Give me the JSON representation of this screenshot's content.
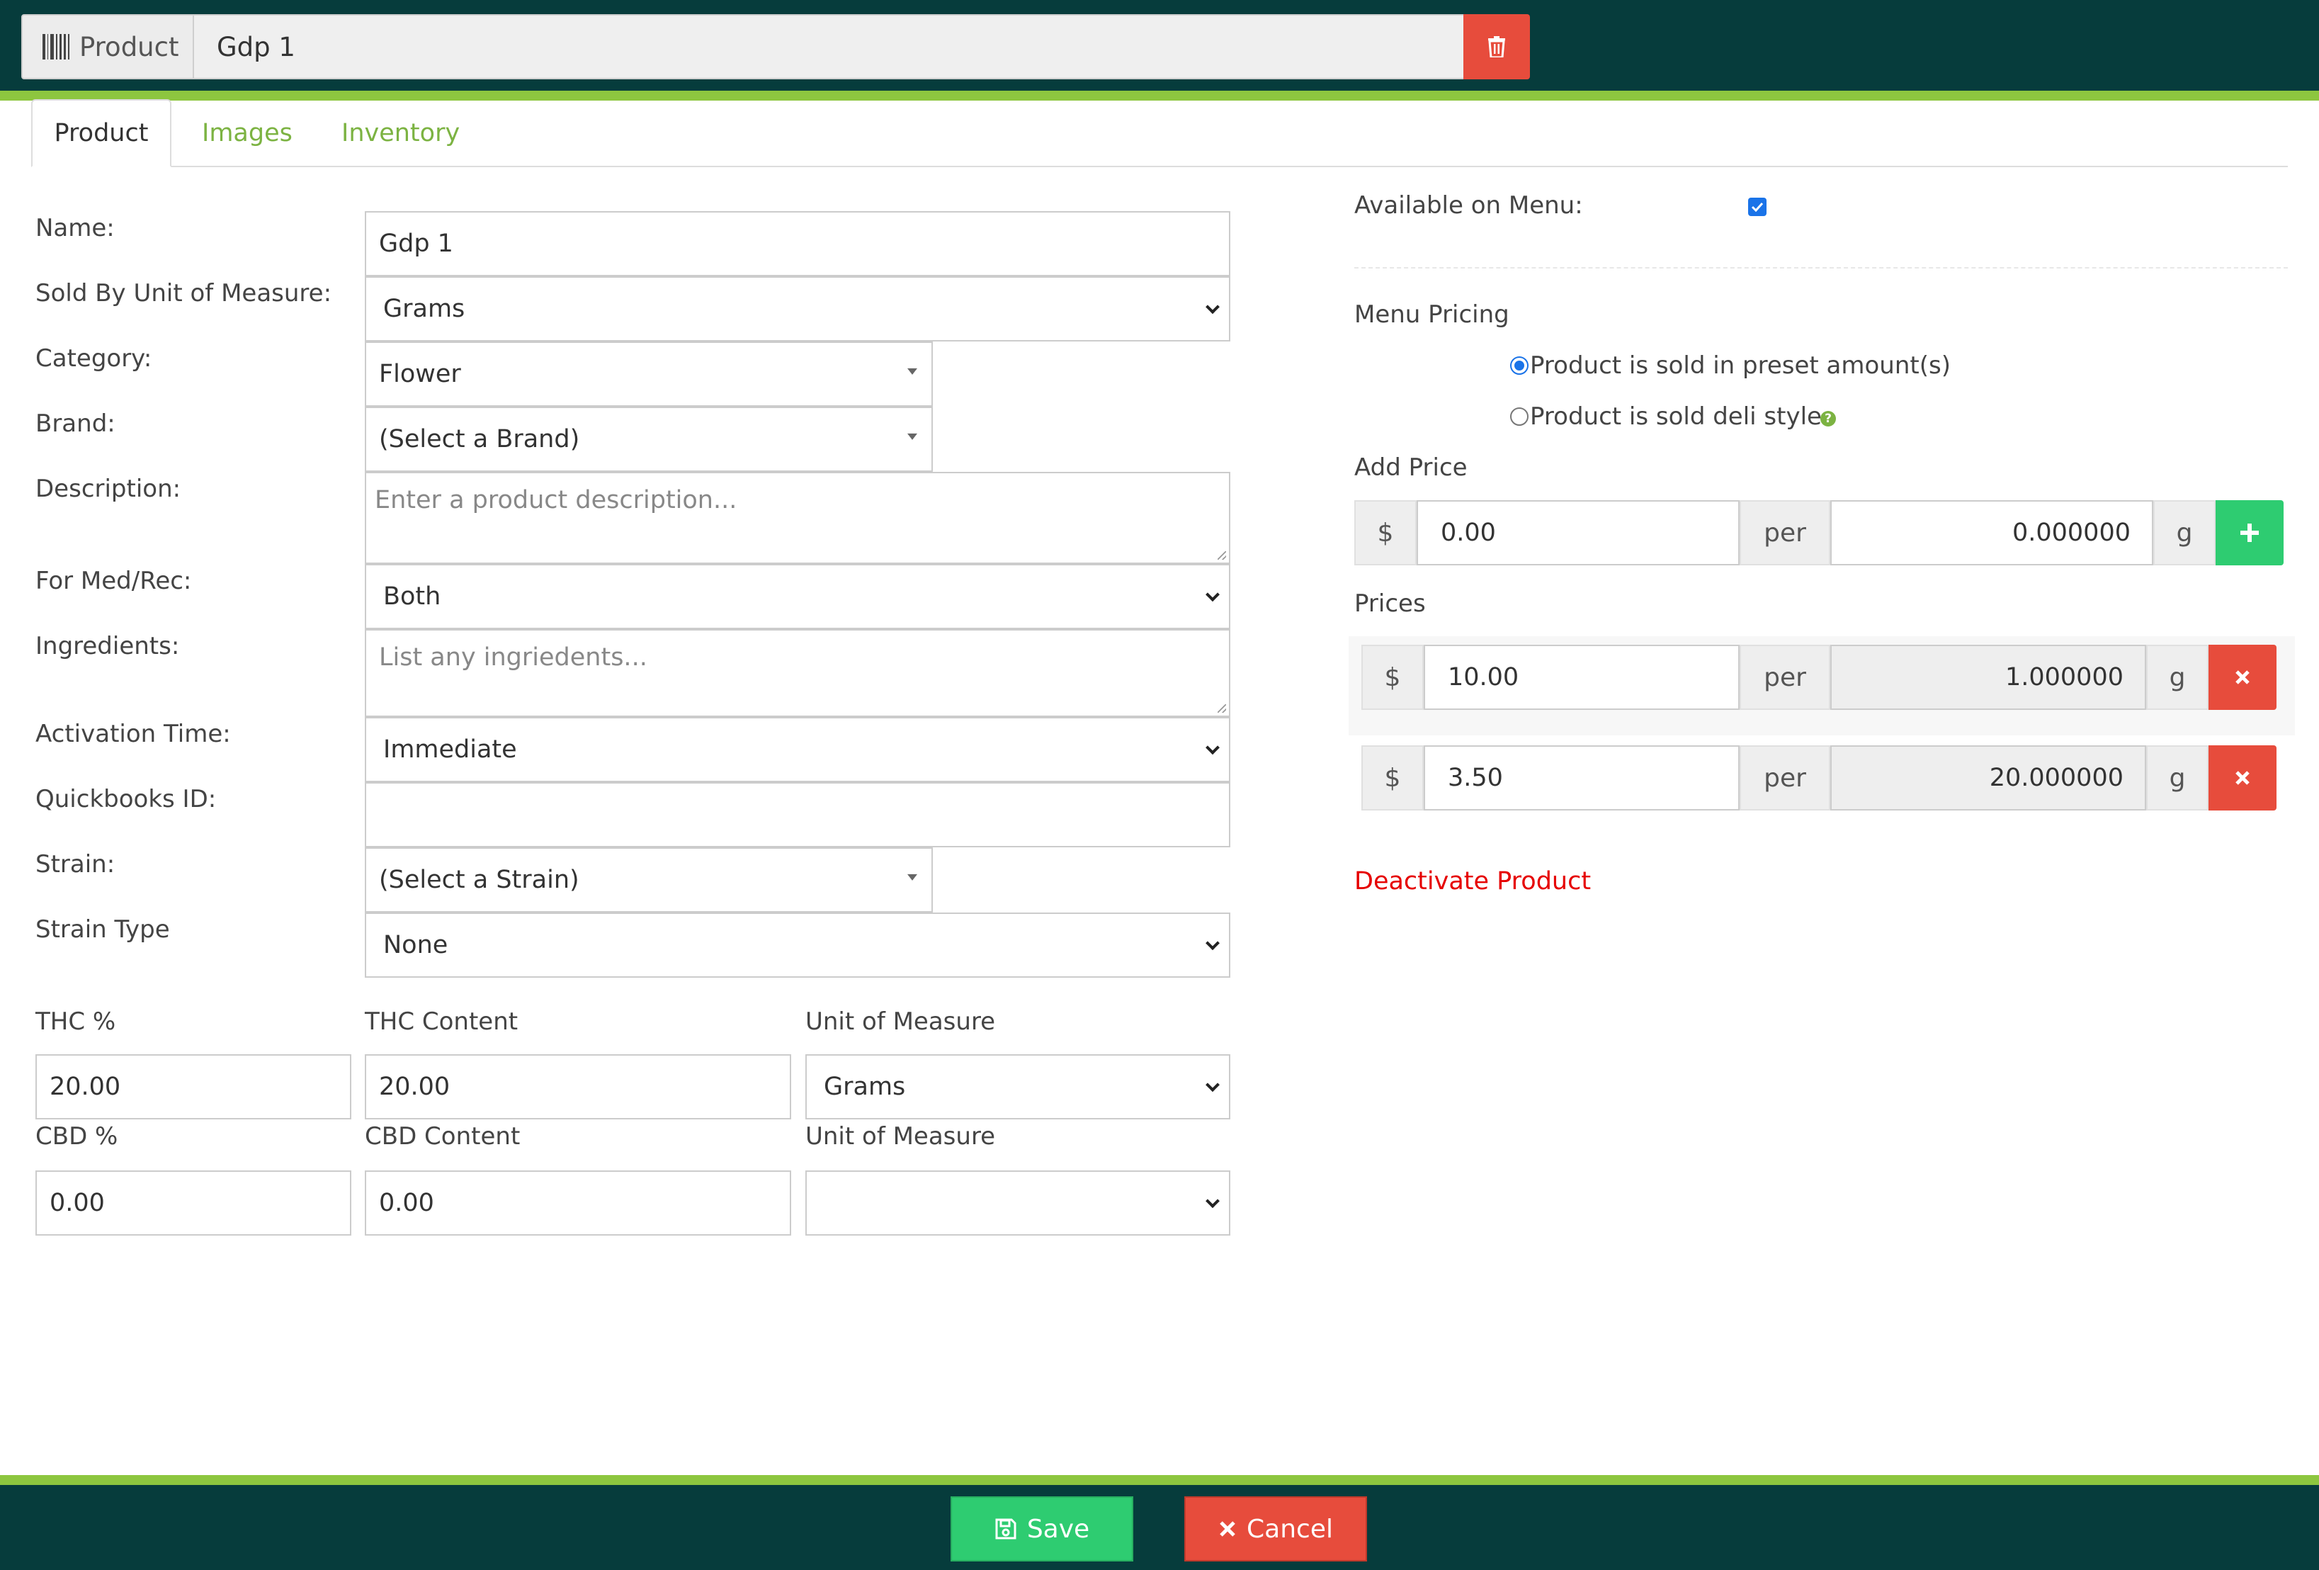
{
  "header": {
    "product_label": "Product",
    "product_name": "Gdp 1"
  },
  "tabs": [
    {
      "label": "Product",
      "active": true
    },
    {
      "label": "Images",
      "active": false
    },
    {
      "label": "Inventory",
      "active": false
    }
  ],
  "form": {
    "name": {
      "label": "Name:",
      "value": "Gdp 1"
    },
    "sold_by": {
      "label": "Sold By Unit of Measure:",
      "value": "Grams"
    },
    "category": {
      "label": "Category:",
      "value": "Flower"
    },
    "brand": {
      "label": "Brand:",
      "value": "(Select a Brand)"
    },
    "description": {
      "label": "Description:",
      "placeholder": "Enter a product description..."
    },
    "med_rec": {
      "label": "For Med/Rec:",
      "value": "Both"
    },
    "ingredients": {
      "label": "Ingredients:",
      "placeholder": "List any ingriedents..."
    },
    "activation_time": {
      "label": "Activation Time:",
      "value": "Immediate"
    },
    "quickbooks_id": {
      "label": "Quickbooks ID:",
      "value": ""
    },
    "strain": {
      "label": "Strain:",
      "value": "(Select a Strain)"
    },
    "strain_type": {
      "label": "Strain Type",
      "value": "None"
    },
    "thc_pct": {
      "label": "THC %",
      "value": "20.00"
    },
    "thc_content": {
      "label": "THC Content",
      "value": "20.00"
    },
    "thc_uom": {
      "label": "Unit of Measure",
      "value": "Grams"
    },
    "cbd_pct": {
      "label": "CBD %",
      "value": "0.00"
    },
    "cbd_content": {
      "label": "CBD Content",
      "value": "0.00"
    },
    "cbd_uom": {
      "label": "Unit of Measure",
      "value": ""
    }
  },
  "menu": {
    "available_label": "Available on Menu:",
    "available": true,
    "pricing_label": "Menu Pricing",
    "option_preset": "Product is sold in preset amount(s)",
    "option_deli": "Product is sold deli style",
    "add_price_label": "Add Price",
    "currency": "$",
    "per": "per",
    "unit": "g",
    "new_price": "0.00",
    "new_amount": "0.000000",
    "prices_label": "Prices",
    "prices": [
      {
        "price": "10.00",
        "amount": "1.000000"
      },
      {
        "price": "3.50",
        "amount": "20.000000"
      }
    ],
    "deactivate_label": "Deactivate Product"
  },
  "footer": {
    "save_label": "Save",
    "cancel_label": "Cancel"
  },
  "colors": {
    "header_bg": "#063c3c",
    "accent_green": "#8dc63f",
    "danger": "#e74c3c",
    "success": "#2ecc71"
  }
}
